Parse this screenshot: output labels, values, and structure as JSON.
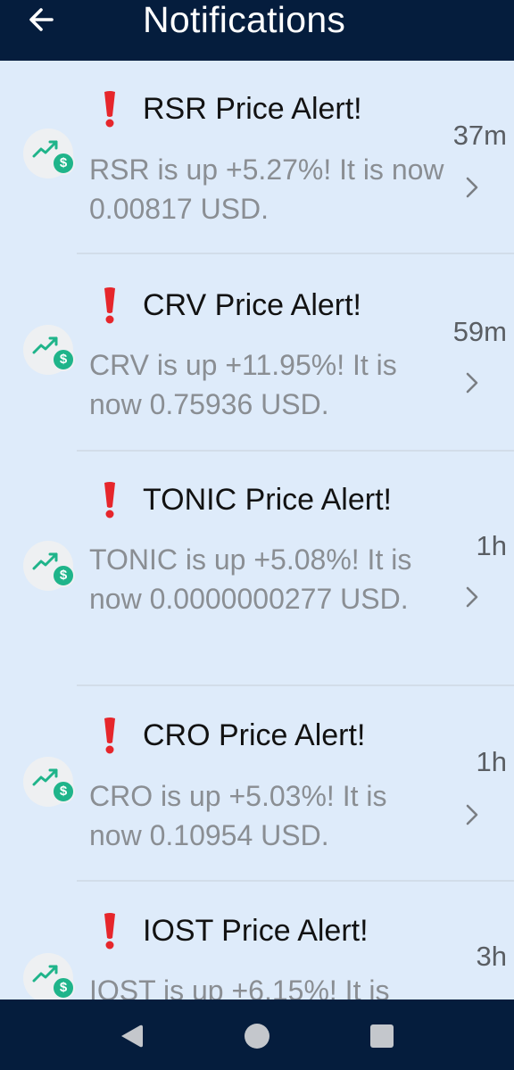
{
  "header": {
    "title": "Notifications",
    "back_icon": "arrow-left-icon"
  },
  "colors": {
    "header_bg": "#051d3d",
    "page_bg": "#deebfa",
    "alert_red": "#e6262b",
    "badge_green": "#1fb48a",
    "trend_green": "#1fb48a"
  },
  "notifications": [
    {
      "title": "RSR Price Alert!",
      "body": "RSR is up +5.27%! It is now 0.00817 USD.",
      "time": "37m"
    },
    {
      "title": "CRV Price Alert!",
      "body": "CRV is up +11.95%! It is now 0.75936 USD.",
      "time": "59m"
    },
    {
      "title": "TONIC Price Alert!",
      "body": "TONIC is up +5.08%! It is now 0.0000000277 USD.",
      "time": "1h"
    },
    {
      "title": "CRO Price Alert!",
      "body": "CRO is up +5.03%! It is now 0.10954 USD.",
      "time": "1h"
    },
    {
      "title": "IOST Price Alert!",
      "body": "IOST is up +6.15%! It is",
      "time": "3h"
    }
  ],
  "icons": {
    "avatar": "trending-up-dollar-icon",
    "alert": "exclamation-icon",
    "chevron": "chevron-right-icon"
  },
  "navbar": {
    "back": "nav-back-icon",
    "home": "nav-home-icon",
    "recents": "nav-recents-icon"
  }
}
